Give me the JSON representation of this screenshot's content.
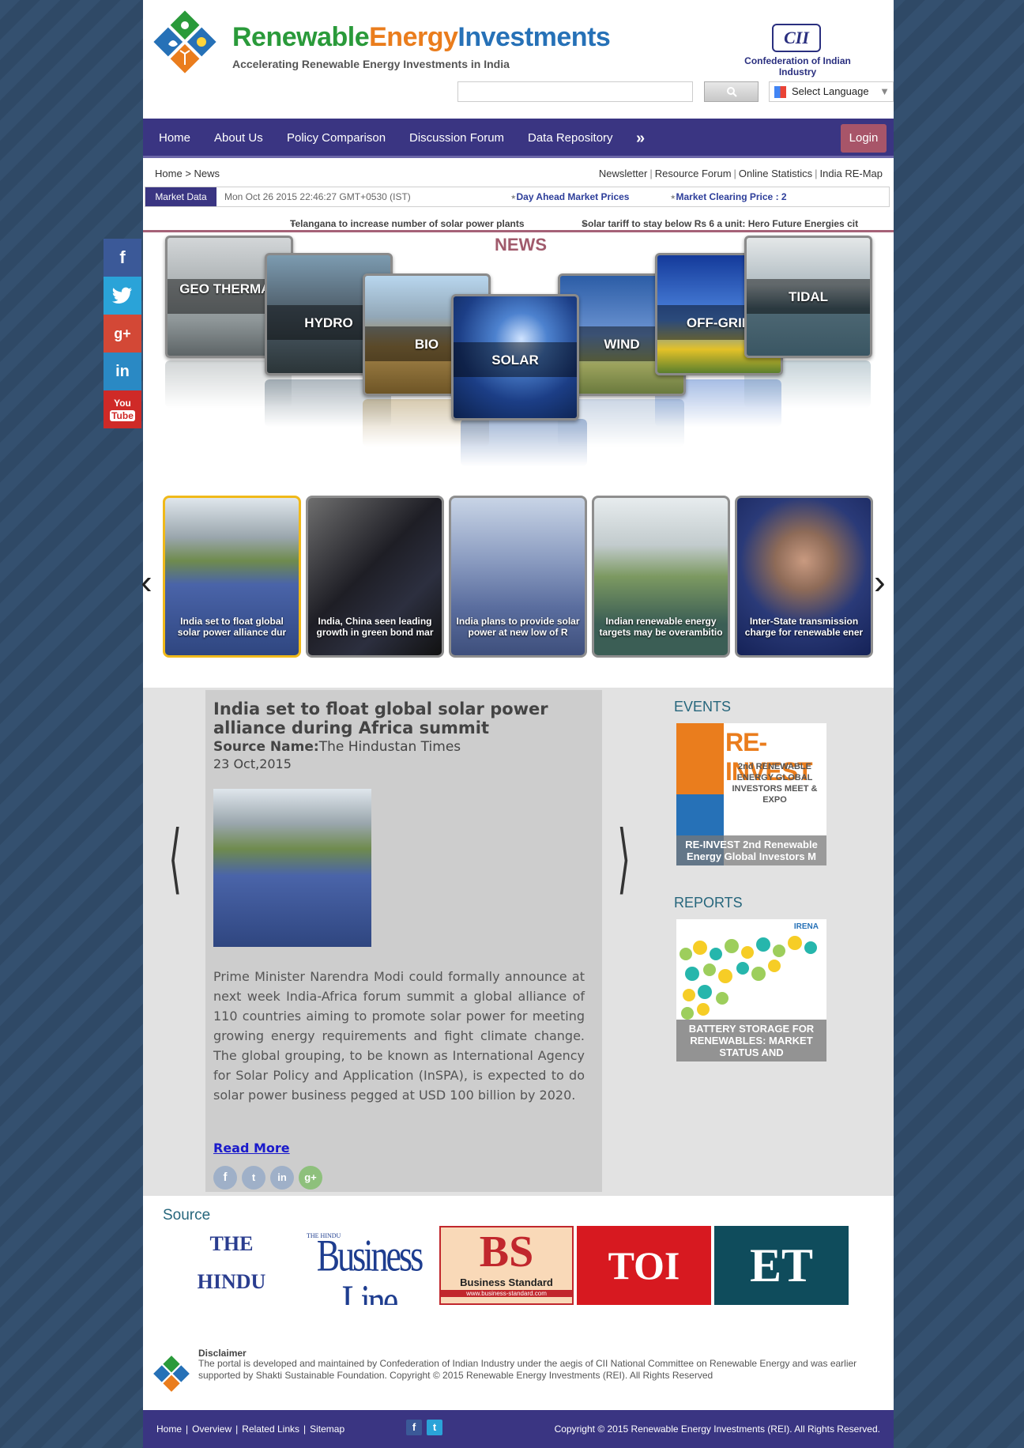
{
  "header": {
    "brand_part1": "Renewable",
    "brand_part2": "Energy",
    "brand_part3": "Investments",
    "tagline": "Accelerating Renewable Energy Investments in India",
    "partner_logo": "CII",
    "partner_name": "Confederation of Indian Industry",
    "search_placeholder": "",
    "language_label": "Select Language"
  },
  "nav": {
    "items": [
      "Home",
      "About Us",
      "Policy Comparison",
      "Discussion Forum",
      "Data Repository",
      "»"
    ],
    "login": "Login"
  },
  "breadcrumb": {
    "home": "Home",
    "separator": ">",
    "current": "News"
  },
  "toplinks": [
    "Newsletter",
    "Resource Forum",
    "Online Statistics",
    "India RE-Map"
  ],
  "market": {
    "label": "Market Data",
    "datetime": "Mon Oct 26 2015 22:46:27 GMT+0530 (IST)",
    "link1": "Day Ahead Market Prices",
    "link2": "Market Clearing Price : 2"
  },
  "ticker": [
    "Telangana to increase number of solar power plants",
    "Solar tariff to stay below Rs 6 a unit: Hero Future Energies cit"
  ],
  "news": {
    "title": "NEWS",
    "categories": [
      "GEO THERMAL",
      "HYDRO",
      "BIO",
      "SOLAR",
      "WIND",
      "OFF-GRID",
      "TIDAL"
    ]
  },
  "thumbnails": [
    "India set to float global solar power alliance dur",
    "India, China seen leading growth in green bond mar",
    "India plans to provide solar power at new low of R",
    "Indian renewable energy targets may be overambitio",
    "Inter-State transmission charge for renewable ener"
  ],
  "article": {
    "title": "India set to float global solar power alliance during Africa summit",
    "source_label": "Source Name:",
    "source": "The Hindustan Times",
    "date": "23 Oct,2015",
    "body": "Prime Minister Narendra Modi could formally announce at next week India-Africa forum summit a global alliance of 110 countries aiming to promote solar power for meeting growing energy requirements and fight climate change. The global grouping, to be known as International Agency for Solar Policy and Application (InSPA), is expected to do solar power business pegged at USD 100 billion by 2020.",
    "read_more": "Read More"
  },
  "events": {
    "heading": "EVENTS",
    "card_title": "RE-INVEST",
    "card_subtitle": "2nd RENEWABLE ENERGY GLOBAL INVESTORS MEET & EXPO",
    "caption": "RE-INVEST 2nd Renewable Energy Global Investors M"
  },
  "reports": {
    "heading": "REPORTS",
    "publisher": "IRENA",
    "caption": "BATTERY STORAGE FOR RENEWABLES: MARKET STATUS AND"
  },
  "source": {
    "heading": "Source",
    "logos": [
      {
        "line1": "THE",
        "line2": "HINDU"
      },
      {
        "line1": "THE HINDU",
        "line2": "Business Line"
      },
      {
        "line1": "BS",
        "line2": "Business Standard",
        "line3": "www.business-standard.com"
      },
      {
        "line1": "TOI"
      },
      {
        "line1": "ET"
      }
    ]
  },
  "disclaimer": {
    "title": "Disclaimer",
    "text": "The portal is developed and maintained by Confederation of Indian Industry under the aegis of CII National Committee on Renewable Energy and was earlier supported by Shakti Sustainable Foundation. Copyright © 2015 Renewable Energy Investments (REI). All Rights Reserved"
  },
  "footer": {
    "links": [
      "Home",
      "Overview",
      "Related Links",
      "Sitemap"
    ],
    "copyright": "Copyright © 2015 Renewable Energy Investments (REI). All Rights Reserved."
  },
  "social": [
    "f",
    "t",
    "g+",
    "in",
    "You Tube"
  ],
  "colors": {
    "nav_bg": "#3a3582",
    "login_bg": "#a85569",
    "accent_teal": "#26667c",
    "news_title": "#a05a6c"
  }
}
